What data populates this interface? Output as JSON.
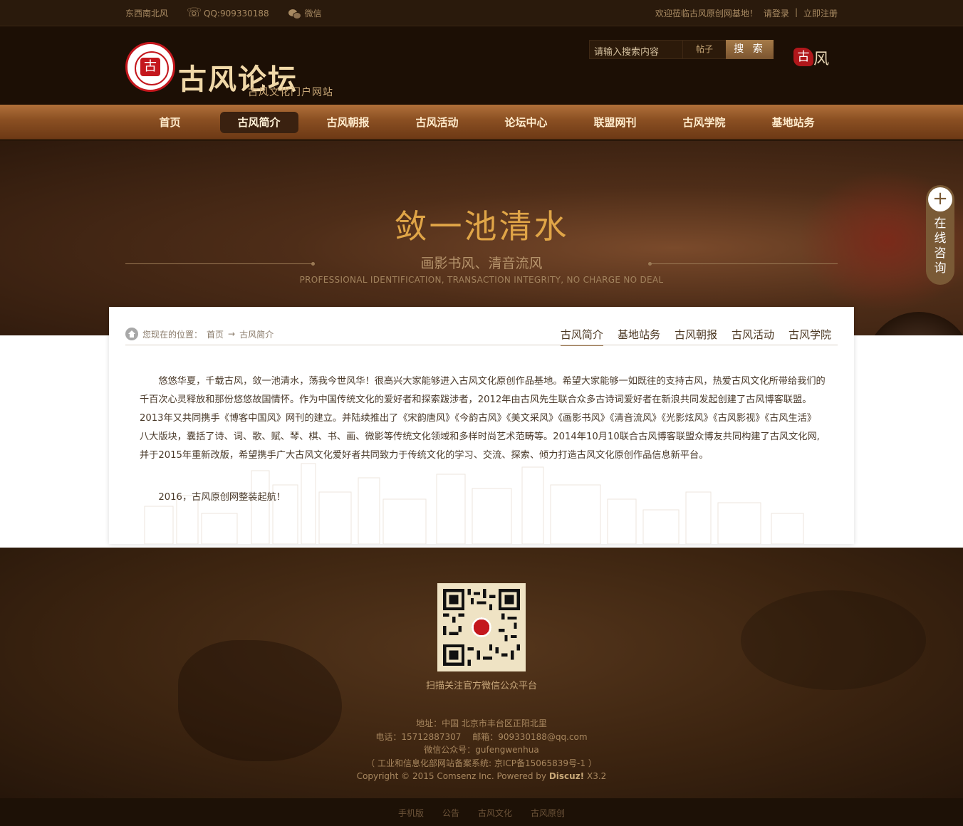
{
  "topbar": {
    "site_name": "东西南北风",
    "qq": "QQ:909330188",
    "wechat": "微信",
    "welcome": "欢迎莅临古风原创网基地！",
    "login": "请登录",
    "divider": "|",
    "register": "立即注册"
  },
  "header": {
    "logo_seal_char": "古",
    "logo_title": "古风论坛",
    "logo_subtitle": "古风文化门户网站",
    "search_placeholder": "请输入搜索内容",
    "search_type": "帖子",
    "search_button": "搜 索",
    "mark_red": "古",
    "mark_text": "风"
  },
  "nav": {
    "items": [
      "首页",
      "古风简介",
      "古风朝报",
      "古风活动",
      "论坛中心",
      "联盟网刊",
      "古风学院",
      "基地站务"
    ],
    "active_index": 1
  },
  "banner": {
    "title": "敛一池清水",
    "subtitle": "画影书风、清音流风",
    "english": "PROFESSIONAL IDENTIFICATION, TRANSACTION INTEGRITY, NO CHARGE NO DEAL"
  },
  "consult": {
    "plus": "+",
    "chars": [
      "在",
      "线",
      "咨",
      "询"
    ]
  },
  "content": {
    "crumb_label": "您现在的位置：",
    "crumb_home": "首页",
    "crumb_arrow": "→",
    "crumb_current": "古风简介",
    "tabs": [
      "古风简介",
      "基地站务",
      "古风朝报",
      "古风活动",
      "古风学院"
    ],
    "paragraph1": "悠悠华夏，千载古风，敛一池清水，荡我今世风华！很高兴大家能够进入古风文化原创作品基地。希望大家能够一如既往的支持古风，热爱古风文化所带给我们的千百次心灵释放和那份悠悠故国情怀。作为中国传统文化的爱好者和探索跋涉者，2012年由古风先生联合众多古诗词爱好者在新浪共同发起创建了古风博客联盟。2013年又共同携手《博客中国风》网刊的建立。并陆续推出了《宋韵唐风》《今韵古风》《美文采风》《画影书风》《清音流风》《光影炫风》《古风影视》《古风生活》八大版块，囊括了诗、词、歌、赋、琴、棋、书、画、微影等传统文化领域和多样时尚艺术范畴等。2014年10月10联合古风博客联盟众博友共同构建了古风文化网,并于2015年重新改版，希望携手广大古风文化爱好者共同致力于传统文化的学习、交流、探索、倾力打造古风文化原创作品信息新平台。",
    "paragraph2": "2016，古风原创网整装起航！"
  },
  "footer": {
    "qr_center": "古",
    "qr_caption": "扫描关注官方微信公众平台",
    "address": "地址：中国 北京市丰台区正阳北里",
    "contact": "电话：15712887307　 邮箱：909330188@qq.com",
    "wechat_id": "微信公众号：gufengwenhua",
    "icp": "（ 工业和信息化部网站备案系统: 京ICP备15065839号-1 ）",
    "copyright_prefix": "Copyright © 2015 Comsenz Inc. Powered by ",
    "copyright_brand": "Discuz!",
    "copyright_version": " X3.2",
    "links": [
      "手机版",
      "公告",
      "古风文化",
      "古风原创"
    ]
  },
  "colors": {
    "accent": "#e0a547",
    "nav_wood": "#8a4f22",
    "seal_red": "#c4171d"
  }
}
